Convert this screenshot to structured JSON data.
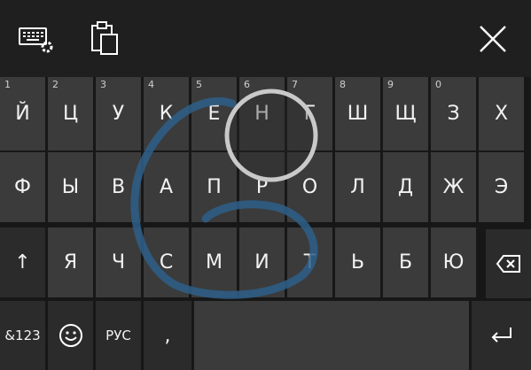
{
  "toolbar": {
    "settings_icon": "keyboard-settings-icon",
    "clipboard_icon": "clipboard-icon",
    "close_icon": "close-icon"
  },
  "rows": [
    {
      "keys": [
        {
          "label": "Й",
          "num": "1"
        },
        {
          "label": "Ц",
          "num": "2"
        },
        {
          "label": "У",
          "num": "3"
        },
        {
          "label": "К",
          "num": "4"
        },
        {
          "label": "Е",
          "num": "5"
        },
        {
          "label": "Н",
          "num": "6"
        },
        {
          "label": "Г",
          "num": "7"
        },
        {
          "label": "Ш",
          "num": "8"
        },
        {
          "label": "Щ",
          "num": "9"
        },
        {
          "label": "З",
          "num": "0"
        },
        {
          "label": "Х",
          "num": ""
        }
      ]
    },
    {
      "keys": [
        {
          "label": "Ф"
        },
        {
          "label": "Ы"
        },
        {
          "label": "В"
        },
        {
          "label": "А"
        },
        {
          "label": "П"
        },
        {
          "label": "Р"
        },
        {
          "label": "О"
        },
        {
          "label": "Л"
        },
        {
          "label": "Д"
        },
        {
          "label": "Ж"
        },
        {
          "label": "Э"
        }
      ]
    },
    {
      "keys": [
        {
          "label": "↑"
        },
        {
          "label": "Я"
        },
        {
          "label": "Ч"
        },
        {
          "label": "С"
        },
        {
          "label": "М"
        },
        {
          "label": "И"
        },
        {
          "label": "Т"
        },
        {
          "label": "Ь"
        },
        {
          "label": "Б"
        },
        {
          "label": "Ю"
        }
      ]
    }
  ],
  "bottom": {
    "symbols": "&123",
    "language": "РУС",
    "comma": ","
  },
  "icons": {
    "backspace": "backspace-icon",
    "emoji": "emoji-icon",
    "enter": "enter-icon"
  },
  "colors": {
    "key": "#3b3b3b",
    "key_dark": "#2b2b2b",
    "background": "#1f1f1f",
    "swipe_trail": "#2e5f8a"
  }
}
